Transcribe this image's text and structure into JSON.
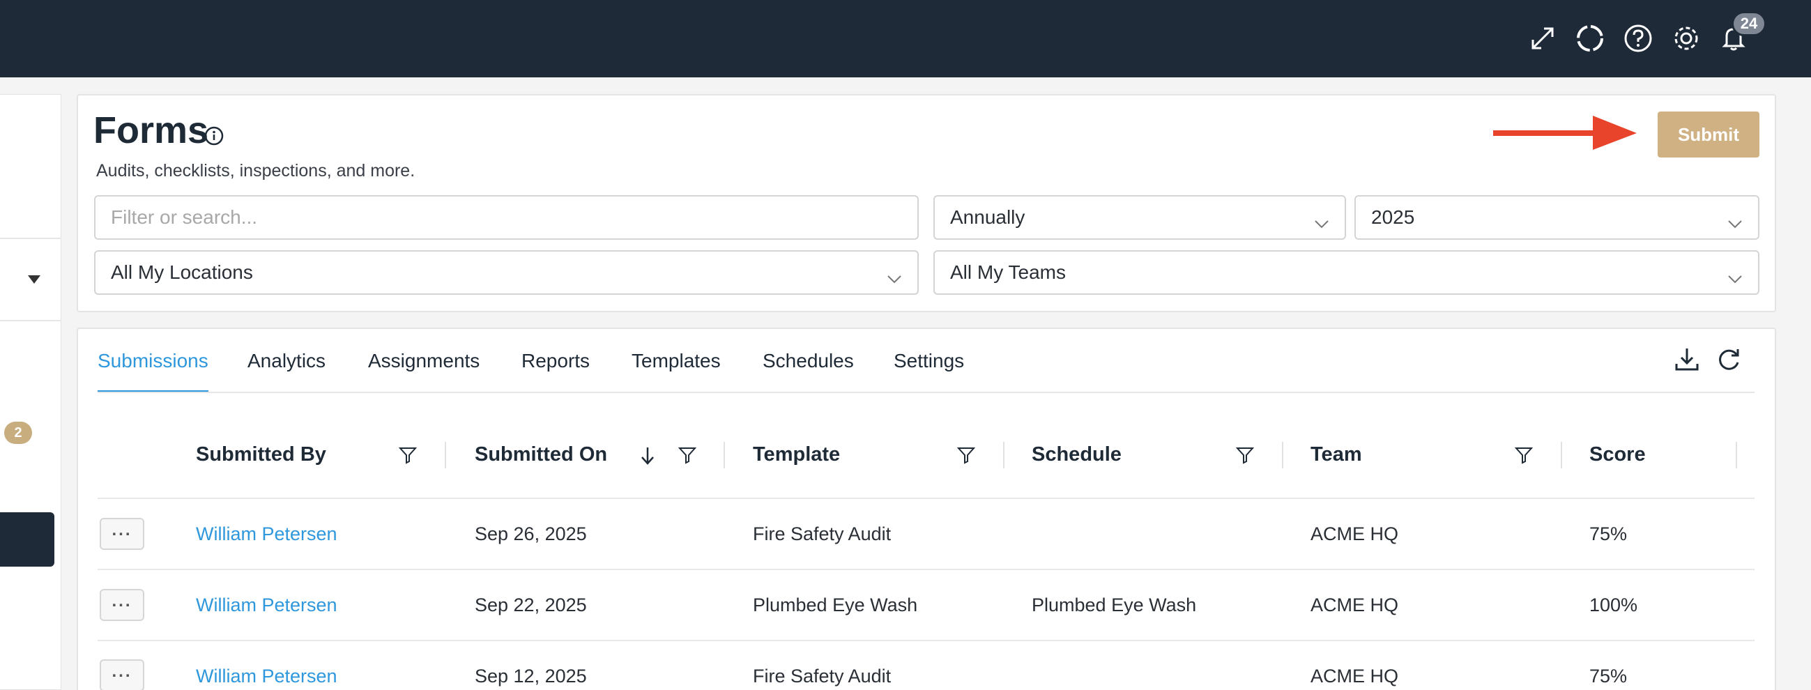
{
  "topbar": {
    "icons": [
      "expand-icon",
      "spinner-icon",
      "help-icon",
      "gear-icon",
      "bell-icon"
    ],
    "notification_count": "24"
  },
  "sidebar": {
    "badge": "2"
  },
  "header": {
    "title": "Forms",
    "subtitle": "Audits, checklists, inspections, and more.",
    "submit_label": "Submit"
  },
  "filters": {
    "search_placeholder": "Filter or search...",
    "period": "Annually",
    "year": "2025",
    "locations": "All My Locations",
    "teams": "All My Teams"
  },
  "tabs": [
    {
      "label": "Submissions",
      "active": true
    },
    {
      "label": "Analytics"
    },
    {
      "label": "Assignments"
    },
    {
      "label": "Reports"
    },
    {
      "label": "Templates"
    },
    {
      "label": "Schedules"
    },
    {
      "label": "Settings"
    }
  ],
  "table": {
    "columns": [
      "Submitted By",
      "Submitted On",
      "Template",
      "Schedule",
      "Team",
      "Score"
    ],
    "rows": [
      {
        "submitted_by": "William Petersen",
        "submitted_on": "Sep 26, 2025",
        "template": "Fire Safety Audit",
        "schedule": "",
        "team": "ACME HQ",
        "score": "75%"
      },
      {
        "submitted_by": "William Petersen",
        "submitted_on": "Sep 22, 2025",
        "template": "Plumbed Eye Wash",
        "schedule": "Plumbed Eye Wash",
        "team": "ACME HQ",
        "score": "100%"
      },
      {
        "submitted_by": "William Petersen",
        "submitted_on": "Sep 12, 2025",
        "template": "Fire Safety Audit",
        "schedule": "",
        "team": "ACME HQ",
        "score": "75%"
      }
    ],
    "row_menu_label": "..."
  },
  "colors": {
    "topbar": "#1f2a38",
    "accent_link": "#2f97dc",
    "submit_button": "#cfb183",
    "arrow": "#e8442b"
  }
}
